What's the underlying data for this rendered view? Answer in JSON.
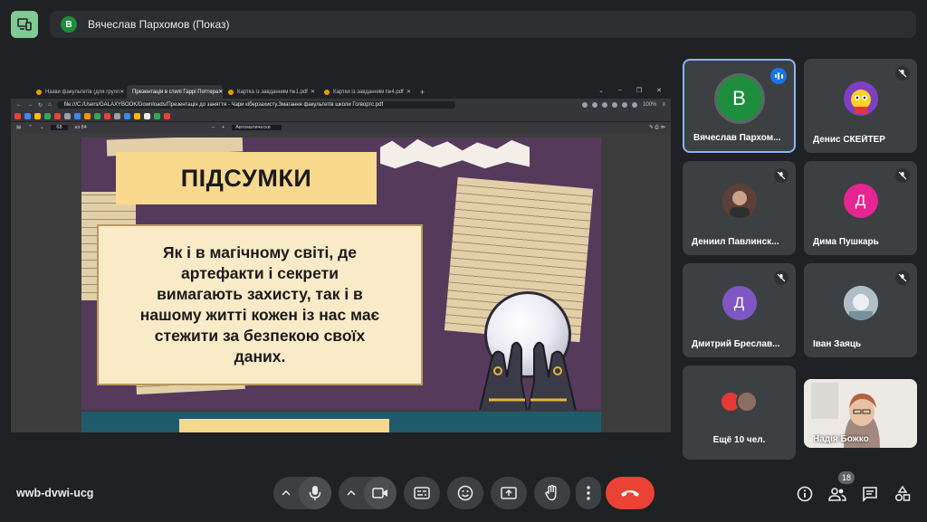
{
  "presenter": {
    "initial": "В",
    "label": "Вячеслав Пархомов (Показ)"
  },
  "browser": {
    "tabs": [
      {
        "title": "Назви факультетів (для групп"
      },
      {
        "title": "Презентація в стилі Гаррі Поттера"
      },
      {
        "title": "Картка із завданням №1.pdf"
      },
      {
        "title": "Картки із завданням №4.pdf"
      }
    ],
    "url": "file:///C:/Users/GALAXYBOOK/Downloads/Презентація до заняття - Чари кіберзахисту.Змагання факультетів школи Гогвортс.pdf",
    "zoom_label": "100%",
    "pdf_page": "68",
    "pdf_page_total": "из 84",
    "pdf_zoom_mode": "Автоматически"
  },
  "slide": {
    "title": "ПІДСУМКИ",
    "lines": [
      "Як і в магічному світі, де",
      "артефакти і секрети",
      "вимагають захисту, так і в",
      "нашому житті кожен із нас має",
      "стежити за безпекою своїх",
      "даних."
    ]
  },
  "participants": [
    {
      "name": "Вячеслав Пархом...",
      "initial": "В",
      "color": "#1e8e3e",
      "speaking": true
    },
    {
      "name": "Денис СКЕЙТЕР",
      "image": "cartoon-avatar",
      "muted": true
    },
    {
      "name": "Дениил Павлинск...",
      "image": "photo-avatar",
      "muted": true
    },
    {
      "name": "Дима Пушкарь",
      "initial": "Д",
      "color": "#e52592",
      "muted": true
    },
    {
      "name": "Дмитрий Бреслав...",
      "initial": "Д",
      "color": "#7e57c2",
      "muted": true
    },
    {
      "name": "Іван Заяць",
      "image": "photo-avatar",
      "muted": true
    },
    {
      "name": "Ещё 10 чел.",
      "group": true
    },
    {
      "name": "Надія Божко",
      "video": true
    }
  ],
  "meeting": {
    "code": "wwb-dvwi-ucg",
    "people_count": "18"
  },
  "colors": {
    "end_call": "#ea4335",
    "accent": "#8ab4f8",
    "present_icon": "#81c995"
  }
}
